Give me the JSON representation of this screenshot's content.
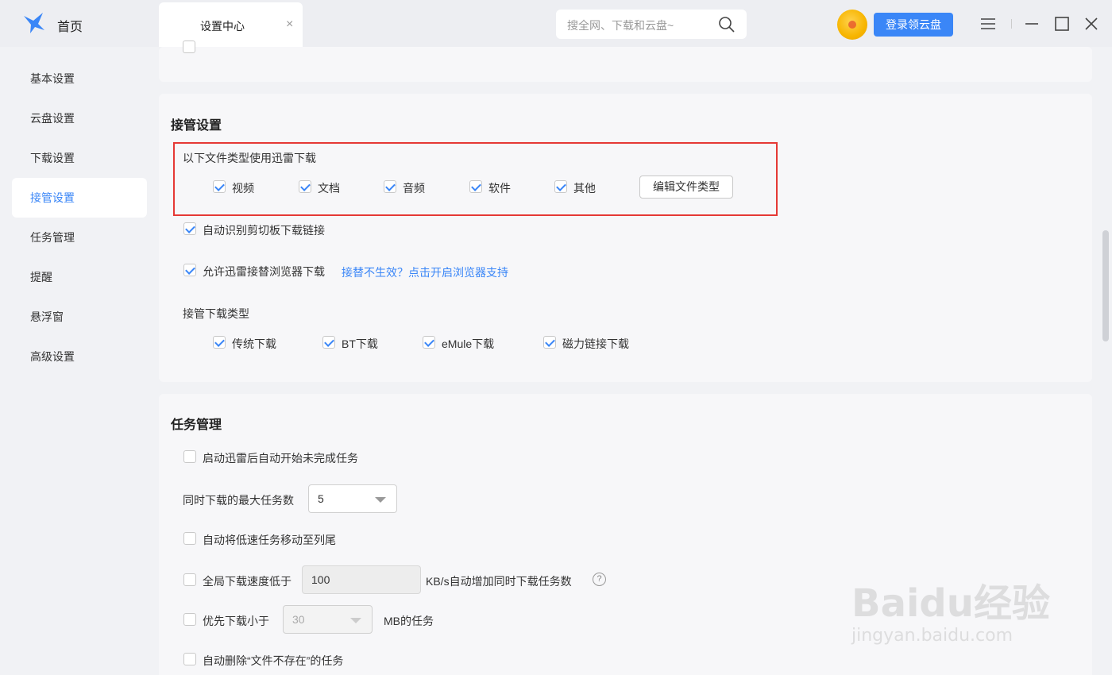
{
  "titlebar": {
    "home_label": "首页",
    "tab_label": "设置中心",
    "tab_close": "×",
    "search_placeholder": "搜全网、下载和云盘~",
    "login_button": "登录领云盘"
  },
  "sidebar": {
    "items": [
      {
        "label": "基本设置"
      },
      {
        "label": "云盘设置"
      },
      {
        "label": "下载设置"
      },
      {
        "label": "接管设置",
        "active": true
      },
      {
        "label": "任务管理"
      },
      {
        "label": "提醒"
      },
      {
        "label": "悬浮窗"
      },
      {
        "label": "高级设置"
      }
    ]
  },
  "takeover": {
    "title": "接管设置",
    "file_types_label": "以下文件类型使用迅雷下载",
    "file_types": [
      {
        "label": "视频",
        "checked": true
      },
      {
        "label": "文档",
        "checked": true
      },
      {
        "label": "音频",
        "checked": true
      },
      {
        "label": "软件",
        "checked": true
      },
      {
        "label": "其他",
        "checked": true
      }
    ],
    "edit_types_button": "编辑文件类型",
    "clipboard_label": "自动识别剪切板下载链接",
    "clipboard_checked": true,
    "browser_label": "允许迅雷接替浏览器下载",
    "browser_checked": true,
    "browser_link": "接替不生效？点击开启浏览器支持",
    "download_types_label": "接管下载类型",
    "download_types": [
      {
        "label": "传统下载",
        "checked": true
      },
      {
        "label": "BT下载",
        "checked": true
      },
      {
        "label": "eMule下载",
        "checked": true
      },
      {
        "label": "磁力链接下载",
        "checked": true
      }
    ]
  },
  "tasks": {
    "title": "任务管理",
    "auto_start_label": "启动迅雷后自动开始未完成任务",
    "auto_start_checked": false,
    "max_tasks_label": "同时下载的最大任务数",
    "max_tasks_value": "5",
    "move_slow_label": "自动将低速任务移动至列尾",
    "move_slow_checked": false,
    "speed_label": "全局下载速度低于",
    "speed_value": "100",
    "speed_suffix": "KB/s自动增加同时下载任务数",
    "speed_checked": false,
    "help_glyph": "?",
    "priority_label": "优先下载小于",
    "priority_value": "30",
    "priority_suffix": "MB的任务",
    "priority_checked": false,
    "delete_missing_label": "自动删除“文件不存在”的任务",
    "delete_missing_checked": false
  },
  "watermark": {
    "line1": "Baidu经验",
    "line2": "jingyan.baidu.com"
  },
  "colors": {
    "accent": "#3a86f7",
    "highlight_border": "#e53935"
  }
}
